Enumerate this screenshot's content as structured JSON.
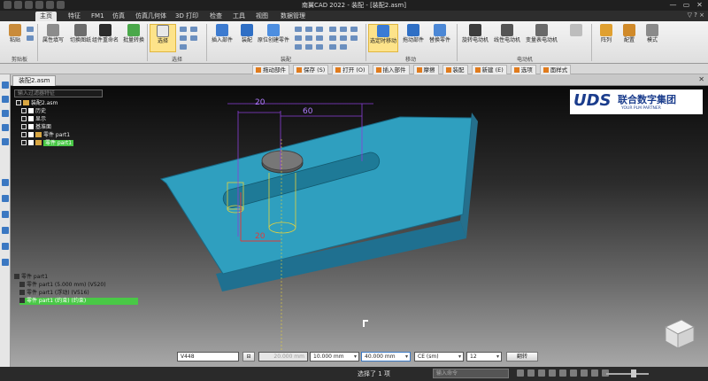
{
  "window": {
    "title": "南翼CAD 2022 - 装配 - [装配2.asm]",
    "controls": [
      "—",
      "▭",
      "✕"
    ]
  },
  "menu": {
    "tabs": [
      "主页",
      "特征",
      "FM1",
      "仿真",
      "仿真几何体",
      "3D 打印",
      "检查",
      "工具",
      "视图",
      "数据管理"
    ],
    "active": "主页",
    "right": "▽ ? ×"
  },
  "ribbon": {
    "buttons": [
      {
        "label": "粘贴",
        "icon": "paste-icon"
      },
      {
        "label": "属性填写",
        "icon": "edit-icon"
      },
      {
        "label": "切换图纸",
        "icon": "switch-icon"
      },
      {
        "label": "组件重命名",
        "icon": "save-icon"
      },
      {
        "label": "批量转换",
        "icon": "convert-icon"
      },
      {
        "label": "选择",
        "icon": "select-icon"
      },
      {
        "label": "插入部件",
        "icon": "insert-icon"
      },
      {
        "label": "装配",
        "icon": "assemble-icon"
      },
      {
        "label": "原位创建零件",
        "icon": "create-icon"
      },
      {
        "label": "选定时移动",
        "icon": "move-icon"
      },
      {
        "label": "拖动部件",
        "icon": "drag-icon"
      },
      {
        "label": "替换零件",
        "icon": "replace-icon"
      },
      {
        "label": "旋转电动机",
        "icon": "rotary-motor-icon"
      },
      {
        "label": "线性电动机",
        "icon": "linear-motor-icon"
      },
      {
        "label": "变量表电动机",
        "icon": "table-motor-icon"
      },
      {
        "label": "阵列",
        "icon": "array-icon"
      },
      {
        "label": "配置",
        "icon": "config-icon"
      },
      {
        "label": "模式",
        "icon": "mode-icon"
      }
    ],
    "groups": [
      "剪贴板",
      "选择",
      "装配",
      "移动",
      "电动机"
    ]
  },
  "toolbar2": {
    "items": [
      "拖动部件",
      "保存 (S)",
      "打开 (O)",
      "插入部件",
      "摩擦",
      "装配",
      "新建 (E)",
      "选项",
      "面样式"
    ]
  },
  "document": {
    "tab": "装配2.asm"
  },
  "tree": {
    "search_placeholder": "输入过滤器特征",
    "nodes": [
      "装配2.asm",
      "历史",
      "显示",
      "基准面",
      "零件 part1",
      "零件 part1"
    ]
  },
  "logo": {
    "main": "UDS",
    "cn": "联合数字集团",
    "sub": "YOUR PLM PARTNER"
  },
  "dimensions": {
    "top_left": "20",
    "top_right": "60",
    "bottom": "20"
  },
  "parts_list": {
    "header": "零件 part1",
    "rows": [
      "零件 part1      (5.000 mm)        (V520)",
      "零件 part1      (浮动)           (V516)",
      "零件 part1      (约束)           (约束)"
    ]
  },
  "inputbar": {
    "field1": "V448",
    "field2": "20.000 mm",
    "field3": "10.000 mm",
    "field4": "40.000 mm",
    "field5": "CE (sm)",
    "field6": "12",
    "button": "翻转"
  },
  "status": {
    "text": "选择了 1 项",
    "command_placeholder": "输入命令"
  },
  "colors": {
    "part": "#2f9fbf",
    "highlight": "#49c846",
    "dimension": "#8b3fd8"
  }
}
